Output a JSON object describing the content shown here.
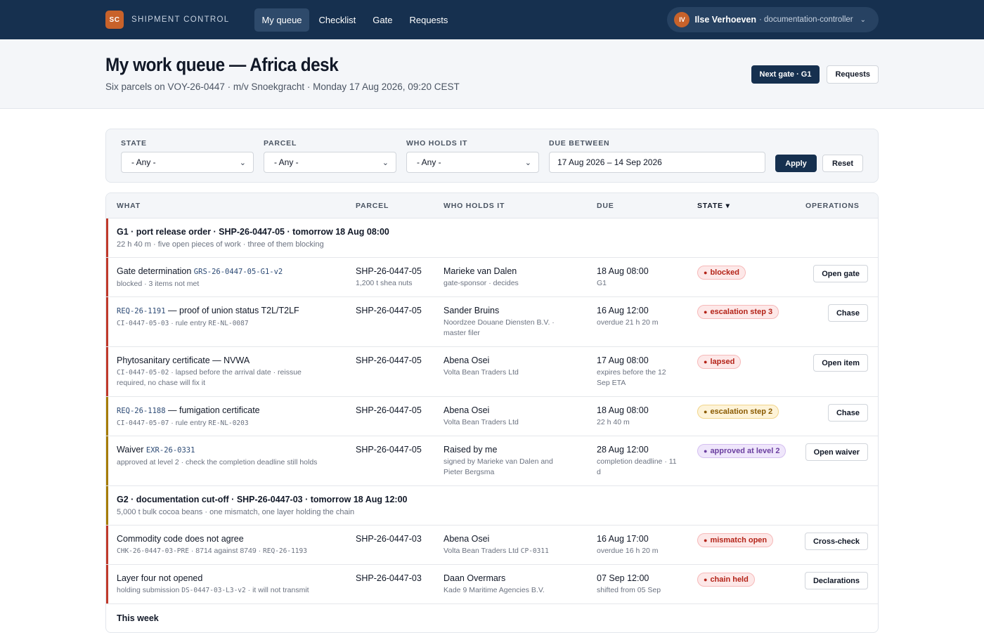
{
  "app": {
    "logo": "SC",
    "brand": "SHIPMENT CONTROL",
    "nav": [
      "My queue",
      "Checklist",
      "Gate",
      "Requests"
    ],
    "user": {
      "initials": "IV",
      "name": "Ilse Verhoeven",
      "role": "· documentation-controller"
    }
  },
  "header": {
    "title": "My work queue — Africa desk",
    "subtitle": "Six parcels on VOY-26-0447 · m/v Snoekgracht · Monday 17 Aug 2026, 09:20 CEST",
    "next_gate": "Next gate · G1",
    "requests": "Requests"
  },
  "filters": {
    "state_label": "STATE",
    "state_value": "- Any -",
    "parcel_label": "PARCEL",
    "parcel_value": "- Any -",
    "holder_label": "WHO HOLDS IT",
    "holder_value": "- Any -",
    "due_label": "DUE BETWEEN",
    "due_value": "17 Aug 2026 – 14 Sep 2026",
    "apply": "Apply",
    "reset": "Reset"
  },
  "table": {
    "headers": [
      "WHAT",
      "PARCEL",
      "WHO HOLDS IT",
      "DUE",
      "STATE ▾",
      "OPERATIONS"
    ],
    "g1": {
      "title": "G1 · port release order · SHP-26-0447-05 · tomorrow 18 Aug 08:00",
      "sub": "22 h 40 m · five open pieces of work · three of them blocking"
    },
    "r1": {
      "what": "Gate determination ",
      "code": "GRS-26-0447-05-G1-v2",
      "meta": "blocked · 3 items not met",
      "parcel": "SHP-26-0447-05",
      "parcel_meta": "1,200 t shea nuts",
      "holder": "Marieke van Dalen",
      "holder_meta": "gate-sponsor · decides",
      "due": "18 Aug 08:00",
      "due_meta": "G1",
      "state": "blocked",
      "op": "Open gate"
    },
    "r2": {
      "code": "REQ-26-1191",
      "what": " — proof of union status T2L/T2LF",
      "meta_code": "CI-0447-05-03",
      "meta": " · rule entry ",
      "meta_code2": "RE-NL-0087",
      "parcel": "SHP-26-0447-05",
      "holder": "Sander Bruins",
      "holder_meta": "Noordzee Douane Diensten B.V. · master filer",
      "due": "16 Aug 12:00",
      "due_meta": "overdue 21 h 20 m",
      "state": "escalation step 3",
      "op": "Chase"
    },
    "r3": {
      "what": "Phytosanitary certificate — NVWA",
      "meta_code": "CI-0447-05-02",
      "meta": " · lapsed before the arrival date · reissue required, no chase will fix it",
      "parcel": "SHP-26-0447-05",
      "holder": "Abena Osei",
      "holder_meta": "Volta Bean Traders Ltd",
      "due": "17 Aug 08:00",
      "due_meta": "expires before the 12 Sep ETA",
      "state": "lapsed",
      "op": "Open item"
    },
    "r4": {
      "code": "REQ-26-1188",
      "what": " — fumigation certificate",
      "meta_code": "CI-0447-05-07",
      "meta": " · rule entry ",
      "meta_code2": "RE-NL-0203",
      "parcel": "SHP-26-0447-05",
      "holder": "Abena Osei",
      "holder_meta": "Volta Bean Traders Ltd",
      "due": "18 Aug 08:00",
      "due_meta": "22 h 40 m",
      "state": "escalation step 2",
      "op": "Chase"
    },
    "r5": {
      "what": "Waiver ",
      "code": "EXR-26-0331",
      "meta": "approved at level 2 · check the completion deadline still holds",
      "parcel": "SHP-26-0447-05",
      "holder": "Raised by me",
      "holder_meta": "signed by Marieke van Dalen and Pieter Bergsma",
      "due": "28 Aug 12:00",
      "due_meta": "completion deadline · 11 d",
      "state": "approved at level 2",
      "op": "Open waiver"
    },
    "g2": {
      "title": "G2 · documentation cut-off · SHP-26-0447-03 · tomorrow 18 Aug 12:00",
      "sub": "5,000 t bulk cocoa beans · one mismatch, one layer holding the chain"
    },
    "r6": {
      "what": "Commodity code does not agree",
      "meta_code": "CHK-26-0447-03-PRE",
      "meta": " · 8714 against 8749 · ",
      "meta_code2": "REQ-26-1193",
      "parcel": "SHP-26-0447-03",
      "holder": "Abena Osei",
      "holder_meta": "Volta Bean Traders Ltd ",
      "holder_code": "CP-0311",
      "due": "16 Aug 17:00",
      "due_meta": "overdue 16 h 20 m",
      "state": "mismatch open",
      "op": "Cross-check"
    },
    "r7": {
      "what": "Layer four not opened",
      "meta": "holding submission ",
      "meta_code": "DS-0447-03-L3-v2",
      "meta2": " · it will not transmit",
      "parcel": "SHP-26-0447-03",
      "holder": "Daan Overmars",
      "holder_meta": "Kade 9 Maritime Agencies B.V.",
      "due": "07 Sep 12:00",
      "due_meta": "shifted from 05 Sep",
      "state": "chain held",
      "op": "Declarations"
    },
    "g3": {
      "title": "This week"
    }
  },
  "colors": {
    "navy": "#16304f",
    "accent": "#c8622a",
    "red": "#c0392b",
    "amber": "#a67c00"
  },
  "icons": {
    "dot": "●",
    "caret": "⌄",
    "sort": "▾"
  }
}
